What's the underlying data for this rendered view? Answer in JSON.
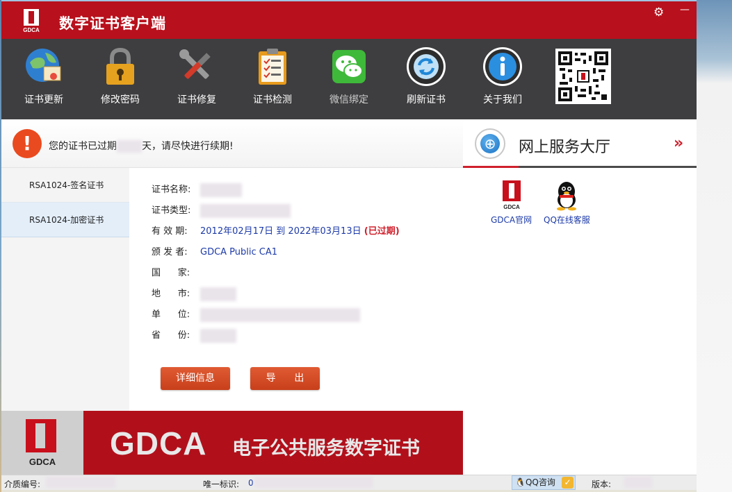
{
  "window": {
    "title": "数字证书客户端",
    "logo_text": "GDCA",
    "settings_icon": "gear-icon",
    "minimize_icon": "minimize-icon"
  },
  "toolbar": {
    "items": [
      {
        "label": "证书更新",
        "icon": "certificate-update-icon"
      },
      {
        "label": "修改密码",
        "icon": "padlock-icon"
      },
      {
        "label": "证书修复",
        "icon": "tools-icon"
      },
      {
        "label": "证书检测",
        "icon": "clipboard-check-icon"
      },
      {
        "label": "微信绑定",
        "icon": "wechat-icon"
      },
      {
        "label": "刷新证书",
        "icon": "refresh-icon"
      },
      {
        "label": "关于我们",
        "icon": "info-icon"
      }
    ],
    "qr_icon": "qr-code-icon"
  },
  "alert": {
    "prefix": "您的证书已过期",
    "suffix": "天，请尽快进行续期!",
    "color": "#ea4a1f"
  },
  "service_hall": {
    "title": "网上服务大厅",
    "more": "»",
    "links": [
      {
        "label": "GDCA官网",
        "icon": "gdca-logo-icon"
      },
      {
        "label": "QQ在线客服",
        "icon": "qq-penguin-icon"
      }
    ]
  },
  "cert_list": [
    {
      "label": "RSA1024-签名证书"
    },
    {
      "label": "RSA1024-加密证书",
      "selected": true
    }
  ],
  "cert_detail": {
    "name_label": "证书名称:",
    "type_label": "证书类型:",
    "validity_label": "有 效 期:",
    "validity_value": "2012年02月17日 到 2022年03月13日",
    "expired_tag": "(已过期)",
    "issuer_label": "颁 发 者:",
    "issuer_value": "GDCA Public CA1",
    "country_label": "国      家:",
    "city_label": "地      市:",
    "org_label": "单      位:",
    "province_label": "省      份:"
  },
  "buttons": {
    "details": "详细信息",
    "export": "导      出"
  },
  "banner": {
    "logo_text": "GDCA",
    "brand": "GDCA",
    "slogan": "电子公共服务数字证书"
  },
  "statusbar": {
    "media_label": "介质编号:",
    "uid_label": "唯一标识:",
    "uid_value": "0",
    "qq_label": "QQ咨询",
    "version_label": "版本:"
  },
  "colors": {
    "brand_red": "#b8101c",
    "toolbar_bg": "#3e3e40",
    "link_blue": "#1c3aa8",
    "button_orange": "#d24a24"
  }
}
